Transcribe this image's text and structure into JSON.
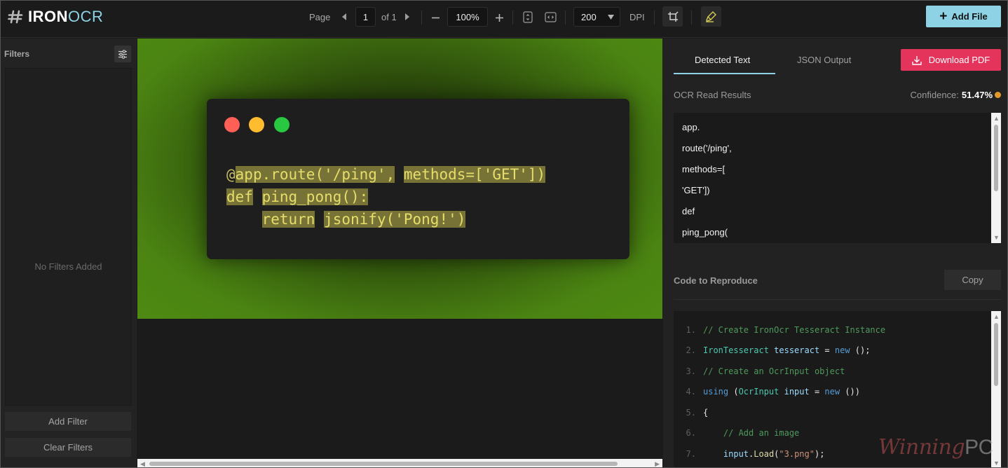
{
  "app": {
    "logo": {
      "bold": "IRON",
      "light": "OCR",
      "icon": "hash-logo-icon"
    },
    "accent": "#8ed3e5",
    "danger": "#e5345c"
  },
  "toolbar": {
    "page_label": "Page",
    "page_value": "1",
    "of_label": "of 1",
    "zoom_value": "100%",
    "dpi_value": "200",
    "dpi_label": "DPI",
    "add_file_label": "Add File"
  },
  "filters": {
    "title": "Filters",
    "empty_text": "No Filters Added",
    "add_label": "Add Filter",
    "clear_label": "Clear Filters"
  },
  "preview": {
    "code_lines": [
      {
        "parts": [
          {
            "t": "@",
            "h": false
          },
          {
            "t": "app.",
            "h": true
          },
          {
            "t": "route('/ping',",
            "h": true
          },
          {
            "t": " ",
            "h": false
          },
          {
            "t": "methods=[",
            "h": true
          },
          {
            "t": "'GET'])",
            "h": true
          }
        ]
      },
      {
        "parts": [
          {
            "t": "def",
            "h": true
          },
          {
            "t": " ",
            "h": false
          },
          {
            "t": "ping_pong(",
            "h": true
          },
          {
            "t": "):",
            "h": true
          }
        ]
      },
      {
        "parts": [
          {
            "t": "    ",
            "h": false
          },
          {
            "t": "return",
            "h": true
          },
          {
            "t": " ",
            "h": false
          },
          {
            "t": "jsonify('Pong!')",
            "h": true
          }
        ]
      }
    ]
  },
  "results": {
    "tabs": [
      {
        "label": "Detected Text",
        "active": true
      },
      {
        "label": "JSON Output",
        "active": false
      }
    ],
    "download_label": "Download PDF",
    "ocr_title": "OCR Read Results",
    "confidence_label": "Confidence:",
    "confidence_value": "51.47%",
    "ocr_lines": [
      "app.",
      "route('/ping',",
      "methods=[",
      "'GET'])",
      "def",
      "ping_pong("
    ],
    "code_title": "Code to Reproduce",
    "copy_label": "Copy",
    "code_lines": [
      {
        "n": "1.",
        "parts": [
          {
            "c": "c-com",
            "t": "// Create IronOcr Tesseract Instance"
          }
        ]
      },
      {
        "n": "2.",
        "parts": [
          {
            "c": "c-type",
            "t": "IronTesseract"
          },
          {
            "c": "c-pl",
            "t": " "
          },
          {
            "c": "c-var",
            "t": "tesseract"
          },
          {
            "c": "c-pl",
            "t": " = "
          },
          {
            "c": "c-kw",
            "t": "new"
          },
          {
            "c": "c-pl",
            "t": " ();"
          }
        ]
      },
      {
        "n": "3.",
        "parts": [
          {
            "c": "c-com",
            "t": "// Create an OcrInput object"
          }
        ]
      },
      {
        "n": "4.",
        "parts": [
          {
            "c": "c-kw",
            "t": "using"
          },
          {
            "c": "c-pl",
            "t": " ("
          },
          {
            "c": "c-type",
            "t": "OcrInput"
          },
          {
            "c": "c-pl",
            "t": " "
          },
          {
            "c": "c-var",
            "t": "input"
          },
          {
            "c": "c-pl",
            "t": " = "
          },
          {
            "c": "c-kw",
            "t": "new"
          },
          {
            "c": "c-pl",
            "t": " ())"
          }
        ]
      },
      {
        "n": "5.",
        "parts": [
          {
            "c": "c-pl",
            "t": "{"
          }
        ]
      },
      {
        "n": "6.",
        "parts": [
          {
            "c": "c-com",
            "t": "    // Add an image"
          }
        ]
      },
      {
        "n": "7.",
        "parts": [
          {
            "c": "c-pl",
            "t": "    "
          },
          {
            "c": "c-var",
            "t": "input"
          },
          {
            "c": "c-pl",
            "t": "."
          },
          {
            "c": "c-fn",
            "t": "Load"
          },
          {
            "c": "c-pl",
            "t": "("
          },
          {
            "c": "c-str",
            "t": "\"3.png\""
          },
          {
            "c": "c-pl",
            "t": ");"
          }
        ]
      }
    ]
  },
  "watermark": {
    "script": "Winning",
    "bold": "PC"
  }
}
